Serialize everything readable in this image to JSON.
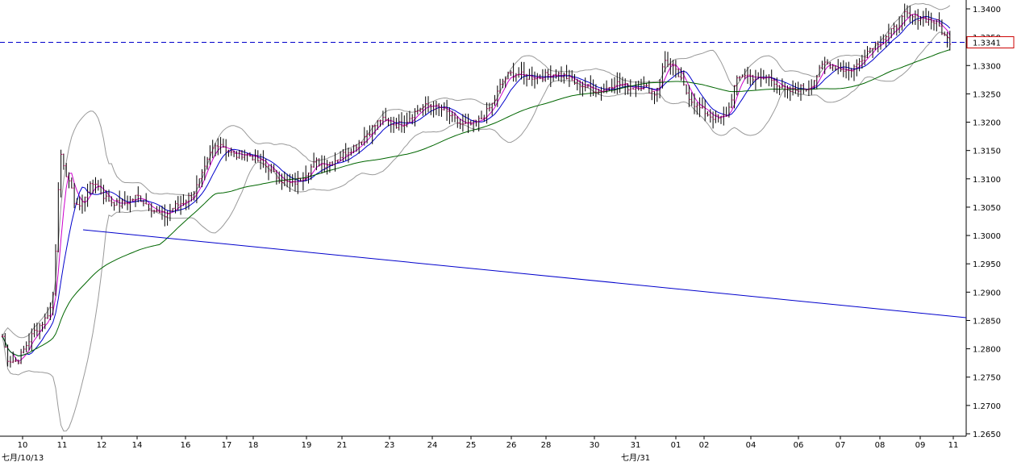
{
  "chart_data": {
    "type": "line",
    "instrument_style": "ohlc-bars",
    "y_axis": {
      "position": "right",
      "range": [
        1.265,
        1.34
      ],
      "ticks": [
        "1.3400",
        "1.3350",
        "1.3300",
        "1.3250",
        "1.3200",
        "1.3150",
        "1.3100",
        "1.3050",
        "1.3000",
        "1.2950",
        "1.2900",
        "1.2850",
        "1.2800",
        "1.2750",
        "1.2700",
        "1.2650"
      ]
    },
    "x_axis": {
      "day_labels": [
        "10",
        "11",
        "12",
        "14",
        "16",
        "17",
        "18",
        "19",
        "21",
        "23",
        "24",
        "25",
        "26",
        "28",
        "30",
        "31",
        "01",
        "02",
        "04",
        "06",
        "07",
        "08",
        "09",
        "11"
      ],
      "period_labels": [
        "七月/10/13",
        "七月/31"
      ]
    },
    "current_price": {
      "value": 1.3341,
      "label": "1.3341",
      "line_color": "#0000cc",
      "box_color": "#cc0000"
    },
    "trendline": {
      "color": "#0000cc",
      "points": [
        {
          "day": "11",
          "value": 1.301
        },
        {
          "day": "11",
          "value": 1.2855
        }
      ]
    },
    "price_path": [
      [
        0,
        1.284
      ],
      [
        10,
        1.278
      ],
      [
        22,
        1.2778
      ],
      [
        30,
        1.28
      ],
      [
        42,
        1.283
      ],
      [
        55,
        1.285
      ],
      [
        65,
        1.288
      ],
      [
        70,
        1.3
      ],
      [
        74,
        1.315
      ],
      [
        78,
        1.312
      ],
      [
        85,
        1.31
      ],
      [
        92,
        1.306
      ],
      [
        100,
        1.305
      ],
      [
        108,
        1.308
      ],
      [
        118,
        1.3095
      ],
      [
        128,
        1.307
      ],
      [
        138,
        1.306
      ],
      [
        148,
        1.3055
      ],
      [
        160,
        1.306
      ],
      [
        170,
        1.307
      ],
      [
        182,
        1.3055
      ],
      [
        195,
        1.304
      ],
      [
        205,
        1.3035
      ],
      [
        215,
        1.305
      ],
      [
        228,
        1.306
      ],
      [
        240,
        1.3075
      ],
      [
        252,
        1.311
      ],
      [
        262,
        1.315
      ],
      [
        272,
        1.3165
      ],
      [
        282,
        1.315
      ],
      [
        292,
        1.314
      ],
      [
        302,
        1.3145
      ],
      [
        312,
        1.314
      ],
      [
        322,
        1.313
      ],
      [
        332,
        1.312
      ],
      [
        342,
        1.3105
      ],
      [
        352,
        1.3095
      ],
      [
        362,
        1.309
      ],
      [
        372,
        1.31
      ],
      [
        382,
        1.3115
      ],
      [
        392,
        1.313
      ],
      [
        402,
        1.3125
      ],
      [
        412,
        1.313
      ],
      [
        422,
        1.314
      ],
      [
        432,
        1.315
      ],
      [
        442,
        1.316
      ],
      [
        452,
        1.3175
      ],
      [
        462,
        1.319
      ],
      [
        472,
        1.3205
      ],
      [
        482,
        1.32
      ],
      [
        492,
        1.3195
      ],
      [
        502,
        1.32
      ],
      [
        512,
        1.3215
      ],
      [
        522,
        1.3225
      ],
      [
        532,
        1.323
      ],
      [
        542,
        1.3225
      ],
      [
        552,
        1.322
      ],
      [
        562,
        1.3205
      ],
      [
        572,
        1.3195
      ],
      [
        582,
        1.3195
      ],
      [
        592,
        1.32
      ],
      [
        602,
        1.3215
      ],
      [
        612,
        1.3235
      ],
      [
        622,
        1.327
      ],
      [
        632,
        1.3285
      ],
      [
        642,
        1.3285
      ],
      [
        652,
        1.328
      ],
      [
        662,
        1.328
      ],
      [
        672,
        1.328
      ],
      [
        682,
        1.3285
      ],
      [
        692,
        1.3285
      ],
      [
        702,
        1.328
      ],
      [
        712,
        1.327
      ],
      [
        722,
        1.3265
      ],
      [
        732,
        1.326
      ],
      [
        742,
        1.3255
      ],
      [
        752,
        1.326
      ],
      [
        762,
        1.327
      ],
      [
        772,
        1.3265
      ],
      [
        782,
        1.326
      ],
      [
        792,
        1.3265
      ],
      [
        802,
        1.326
      ],
      [
        812,
        1.325
      ],
      [
        818,
        1.3275
      ],
      [
        824,
        1.331
      ],
      [
        832,
        1.33
      ],
      [
        842,
        1.328
      ],
      [
        852,
        1.325
      ],
      [
        862,
        1.323
      ],
      [
        872,
        1.322
      ],
      [
        882,
        1.321
      ],
      [
        892,
        1.3205
      ],
      [
        902,
        1.3215
      ],
      [
        912,
        1.327
      ],
      [
        922,
        1.3285
      ],
      [
        932,
        1.328
      ],
      [
        942,
        1.3275
      ],
      [
        952,
        1.328
      ],
      [
        962,
        1.327
      ],
      [
        972,
        1.3255
      ],
      [
        982,
        1.3255
      ],
      [
        992,
        1.326
      ],
      [
        1002,
        1.326
      ],
      [
        1012,
        1.328
      ],
      [
        1022,
        1.3305
      ],
      [
        1032,
        1.33
      ],
      [
        1042,
        1.3295
      ],
      [
        1052,
        1.329
      ],
      [
        1062,
        1.33
      ],
      [
        1072,
        1.332
      ],
      [
        1082,
        1.3335
      ],
      [
        1092,
        1.3345
      ],
      [
        1102,
        1.3355
      ],
      [
        1112,
        1.337
      ],
      [
        1122,
        1.339
      ],
      [
        1132,
        1.3385
      ],
      [
        1142,
        1.3385
      ],
      [
        1152,
        1.338
      ],
      [
        1162,
        1.3375
      ],
      [
        1172,
        1.335
      ],
      [
        1180,
        1.3341
      ]
    ]
  }
}
